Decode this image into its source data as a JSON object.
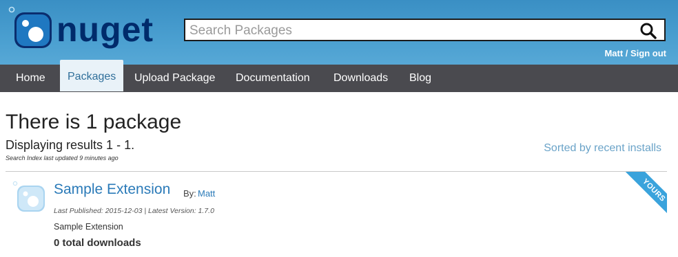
{
  "header": {
    "logo_text": "nuget",
    "search": {
      "placeholder": "Search Packages",
      "value": ""
    },
    "user_link": "Matt / Sign out",
    "search_icon": "search-icon"
  },
  "nav": {
    "items": [
      {
        "label": "Home",
        "active": false
      },
      {
        "label": "Packages",
        "active": true
      },
      {
        "label": "Upload Package",
        "active": false
      },
      {
        "label": "Documentation",
        "active": false
      },
      {
        "label": "Downloads",
        "active": false
      },
      {
        "label": "Blog",
        "active": false
      }
    ]
  },
  "results": {
    "heading": "There is 1 package",
    "displaying": "Displaying results 1 - 1.",
    "index_note": "Search Index last updated 9 minutes ago",
    "sort_label": "Sorted by recent installs"
  },
  "package": {
    "title": "Sample Extension",
    "by_label": "By:",
    "author": "Matt",
    "meta": "Last Published: 2015-12-03 | Latest Version: 1.7.0",
    "description": "Sample Extension",
    "downloads": "0 total downloads",
    "badge": "YOURS",
    "icon": "package-icon"
  },
  "colors": {
    "header_bg": "#4a9fd0",
    "nav_bg": "#4a4a4f",
    "link": "#2a7ab8",
    "badge": "#3aa3dc"
  }
}
